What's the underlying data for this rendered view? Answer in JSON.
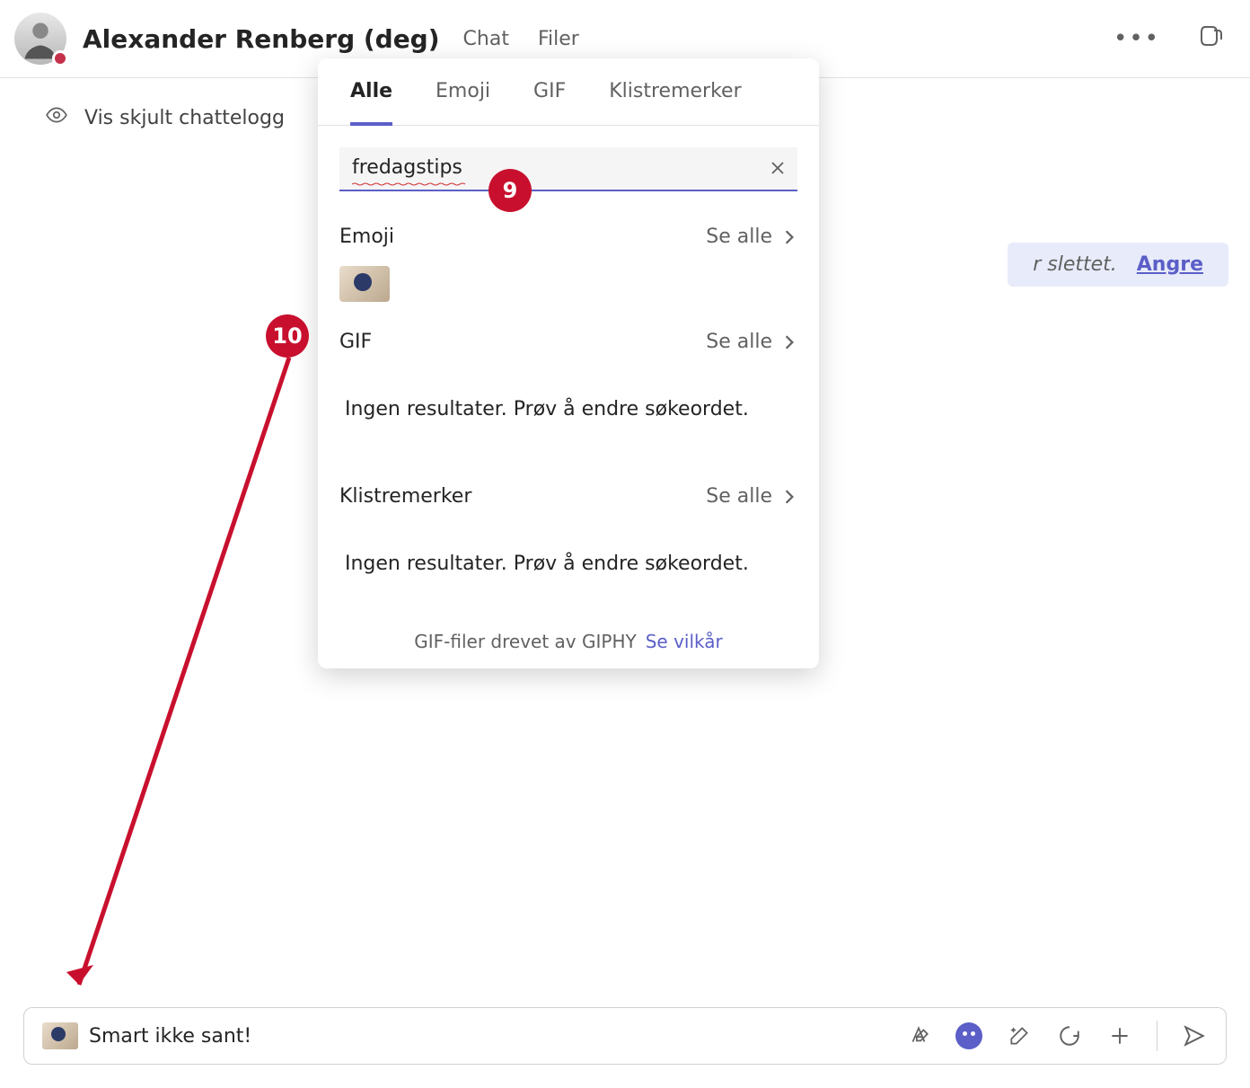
{
  "header": {
    "user_name": "Alexander Renberg (deg)",
    "presence_color": "#c4314b",
    "tabs": {
      "chat": "Chat",
      "files": "Filer"
    }
  },
  "chatlog": {
    "show_hidden": "Vis skjult chattelogg",
    "deleted_suffix": "r slettet.",
    "undo": "Angre"
  },
  "picker": {
    "tabs": {
      "all": "Alle",
      "emoji": "Emoji",
      "gif": "GIF",
      "stickers": "Klistremerker"
    },
    "search_value": "fredagstips",
    "sections": {
      "emoji": {
        "title": "Emoji",
        "see_all": "Se alle"
      },
      "gif": {
        "title": "GIF",
        "see_all": "Se alle",
        "empty": "Ingen resultater. Prøv å endre søkeordet."
      },
      "stick": {
        "title": "Klistremerker",
        "see_all": "Se alle",
        "empty": "Ingen resultater. Prøv å endre søkeordet."
      }
    },
    "giphy": {
      "text": "GIF-filer drevet av GIPHY",
      "link": "Se vilkår"
    }
  },
  "composer": {
    "text": "Smart ikke sant!"
  },
  "annotations": {
    "badge9": "9",
    "badge10": "10"
  }
}
